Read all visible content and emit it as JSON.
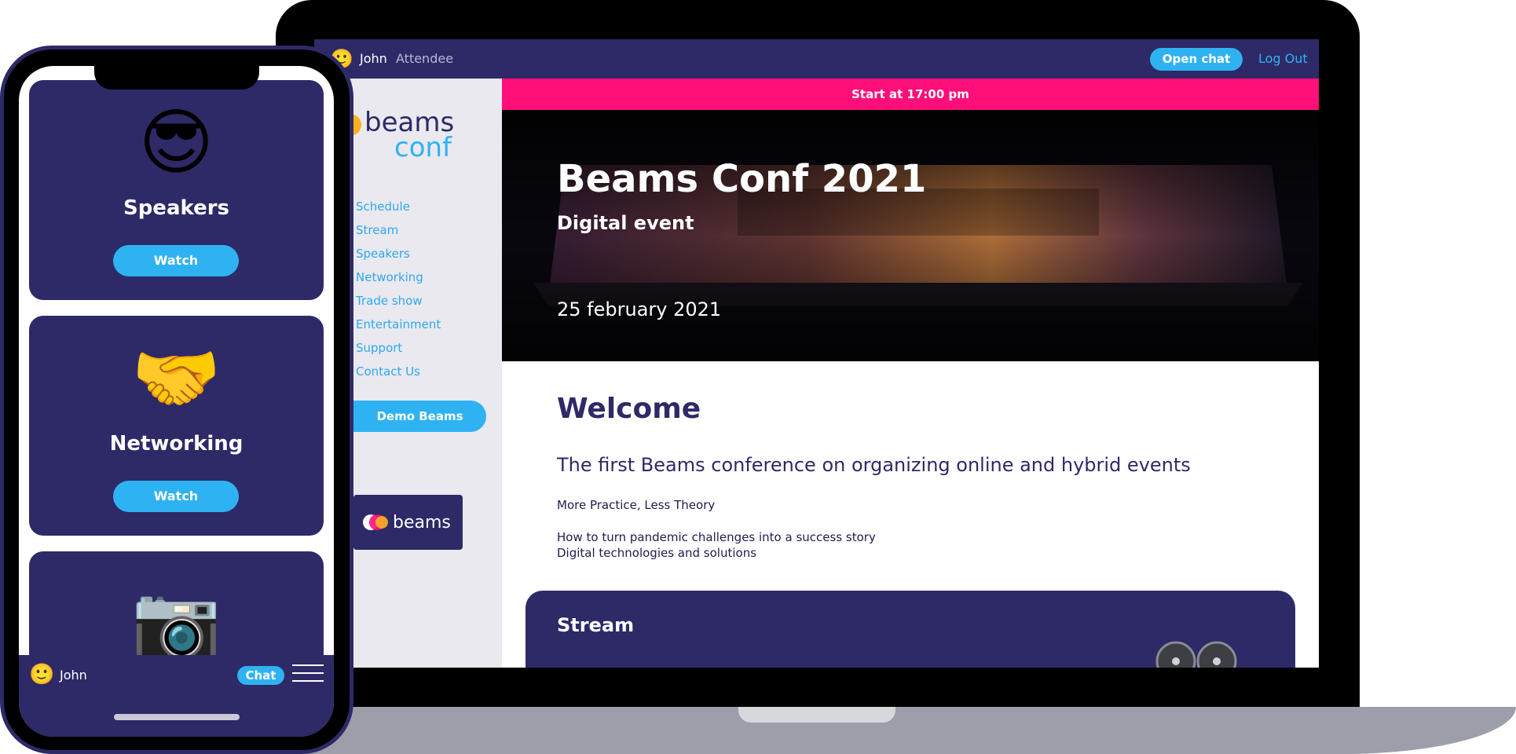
{
  "desktop": {
    "topbar": {
      "user_name": "John",
      "user_role": "Attendee",
      "open_chat_label": "Open chat",
      "logout_label": "Log Out",
      "avatar_icon": "slightly-smiling-face-emoji"
    },
    "sidebar": {
      "logo_alt": "beams conf logo",
      "nav": [
        "Schedule",
        "Stream",
        "Speakers",
        "Networking",
        "Trade show",
        "Entertainment",
        "Support",
        "Contact Us"
      ],
      "demo_button": "Demo Beams",
      "partner_logo": "beams"
    },
    "banner": "Start at 17:00 pm",
    "hero": {
      "title": "Beams Conf 2021",
      "subtitle": "Digital event",
      "date": "25 february 2021"
    },
    "welcome": {
      "heading": "Welcome",
      "tagline": "The first Beams conference on organizing online and hybrid events",
      "line1": "More Practice, Less Theory",
      "line2": "How to turn pandemic challenges into a success story",
      "line3": "Digital technologies and solutions"
    },
    "stream_card": {
      "title": "Stream",
      "icon": "film-reel-icon"
    }
  },
  "mobile": {
    "cards": [
      {
        "emoji": "😎",
        "title": "Speakers",
        "button": "Watch"
      },
      {
        "emoji": "🤝",
        "title": "Networking",
        "button": "Watch"
      },
      {
        "emoji": "📷",
        "title": "",
        "button": ""
      }
    ],
    "bottom_bar": {
      "user_name": "John",
      "chat_label": "Chat",
      "avatar_icon": "slightly-smiling-face-emoji",
      "menu_icon": "hamburger-menu-icon"
    }
  },
  "colors": {
    "navy": "#2e2a68",
    "accent_blue": "#2fb2f2",
    "banner_pink": "#ff0f79",
    "sidebar_bg": "#e9e9ef",
    "laptop_base": "#9c9fa9"
  }
}
